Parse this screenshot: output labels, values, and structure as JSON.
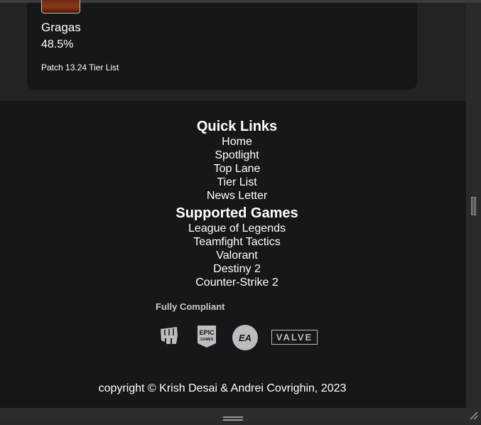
{
  "card": {
    "champion_name": "Gragas",
    "win_rate": "48.5%",
    "link_label": "Patch 13.24 Tier List"
  },
  "footer": {
    "quick_links_heading": "Quick Links",
    "quick_links": [
      "Home",
      "Spotlight",
      "Top Lane",
      "Tier List",
      "News Letter"
    ],
    "supported_games_heading": "Supported Games",
    "games": [
      "League of Legends",
      "Teamfight Tactics",
      "Valorant",
      "Destiny 2",
      "Counter-Strike 2"
    ],
    "compliance_label": "Fully Compliant",
    "logos": {
      "epic_top": "EPIC",
      "epic_bottom": "GAMES",
      "ea": "EA",
      "valve": "VALVE"
    },
    "copyright": "copyright © Krish Desai & Andrei Covrighin, 2023"
  },
  "icons": [
    "riot-fist-icon",
    "epic-games-logo-icon",
    "ea-logo-icon",
    "valve-logo-icon"
  ],
  "colors": {
    "page_bg": "#1b1c1f",
    "card_bg": "#16171b",
    "logo_gray": "#bdbdbd"
  }
}
